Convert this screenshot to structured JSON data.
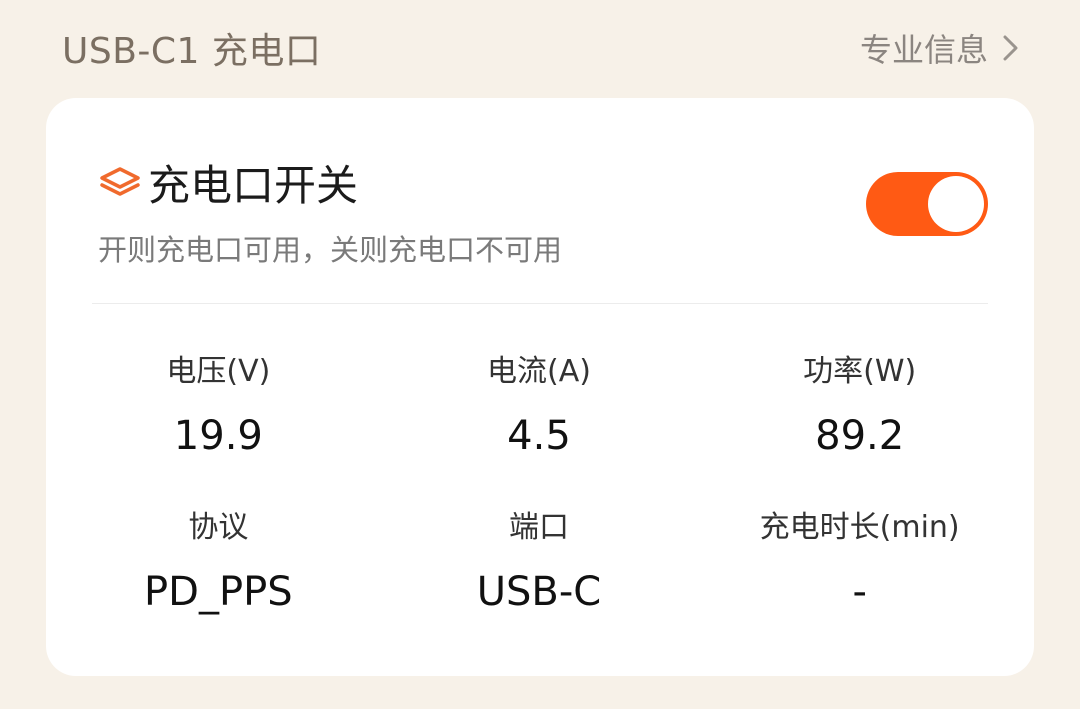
{
  "header": {
    "title": "USB-C1 充电口",
    "link_label": "专业信息"
  },
  "switch": {
    "title": "充电口开关",
    "subtitle": "开则充电口可用，关则充电口不可用",
    "state": "on"
  },
  "colors": {
    "accent": "#ff5a14",
    "background": "#f7f1e8",
    "card": "#ffffff"
  },
  "stats": [
    {
      "label": "电压(V)",
      "value": "19.9"
    },
    {
      "label": "电流(A)",
      "value": "4.5"
    },
    {
      "label": "功率(W)",
      "value": "89.2"
    },
    {
      "label": "协议",
      "value": "PD_PPS"
    },
    {
      "label": "端口",
      "value": "USB-C"
    },
    {
      "label": "充电时长(min)",
      "value": "-"
    }
  ]
}
